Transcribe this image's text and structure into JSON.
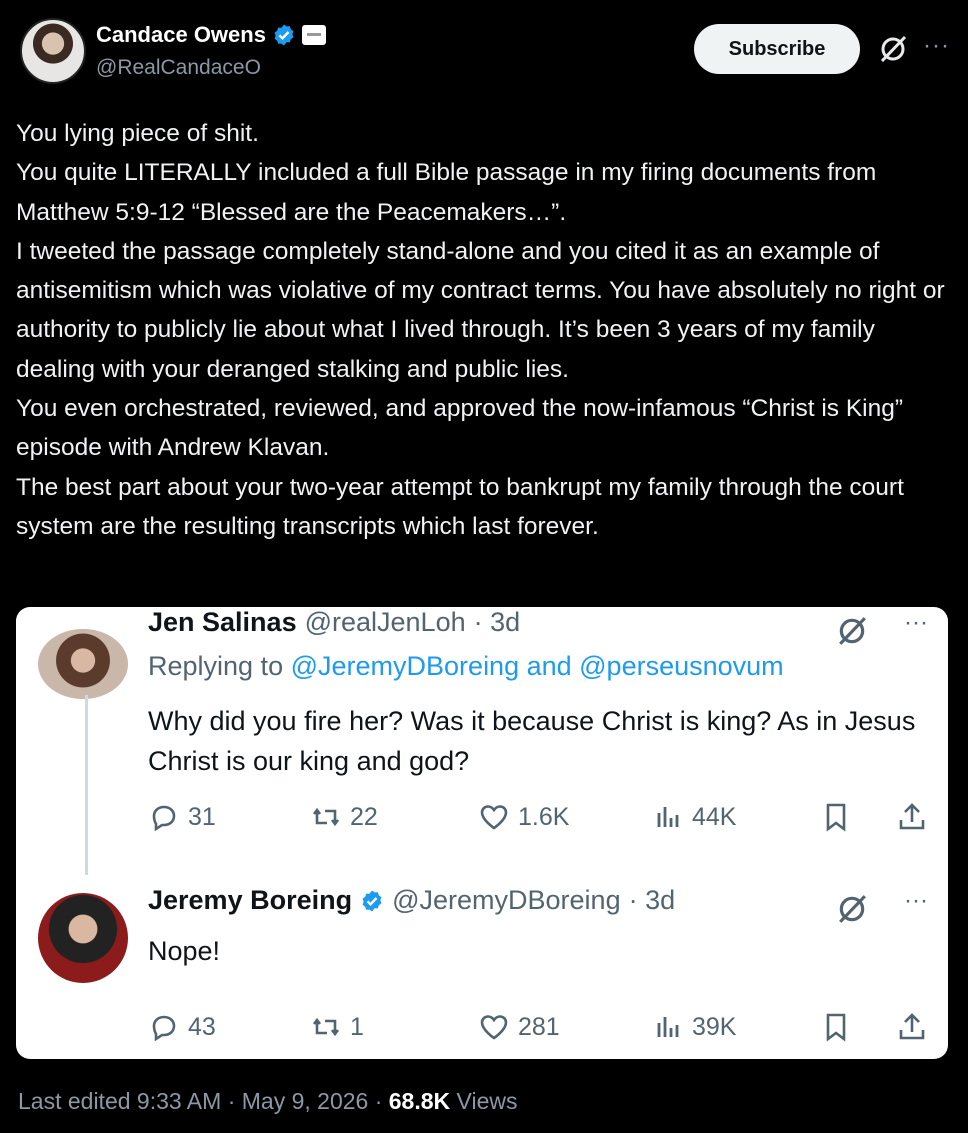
{
  "author": {
    "name": "Candace Owens",
    "handle": "@RealCandaceO"
  },
  "subscribe_label": "Subscribe",
  "more_label": "···",
  "post_text": "You lying piece of shit.\nYou quite LITERALLY included a full Bible passage in my firing documents from Matthew 5:9-12 “Blessed are the Peacemakers…”.\nI tweeted the passage completely stand-alone and you cited it as an example of antisemitism which was violative of my contract terms. You have absolutely no right or authority to publicly lie about what I lived through. It’s been 3 years of my family dealing with your deranged stalking and public lies.\nYou even orchestrated, reviewed, and approved the now-infamous “Christ is King” episode with Andrew Klavan.\nThe best part about your two-year attempt to bankrupt my family through the court system are the resulting transcripts which last forever.",
  "quote": {
    "reply1": {
      "name": "Jen Salinas",
      "handle": "@realJenLoh",
      "time": "· 3d",
      "replying_prefix": "Replying to",
      "replying_to": "@JeremyDBoreing and @perseusnovum",
      "text": "Why did you fire her? Was it because Christ is king? As in Jesus Christ is our king and god?",
      "replies": "31",
      "reposts": "22",
      "likes": "1.6K",
      "views": "44K"
    },
    "reply2": {
      "name": "Jeremy Boreing",
      "handle": "@JeremyDBoreing",
      "time": "· 3d",
      "text": "Nope!",
      "replies": "43",
      "reposts": "1",
      "likes": "281",
      "views": "39K"
    }
  },
  "footer": {
    "edited": "Last edited 9:33 AM · May 9, 2026 ·",
    "views_count": "68.8K",
    "views_label": "Views"
  },
  "colors": {
    "background": "#000000",
    "verified": "#1d9bf0",
    "link": "#1d9bf0",
    "muted": "#536471"
  }
}
